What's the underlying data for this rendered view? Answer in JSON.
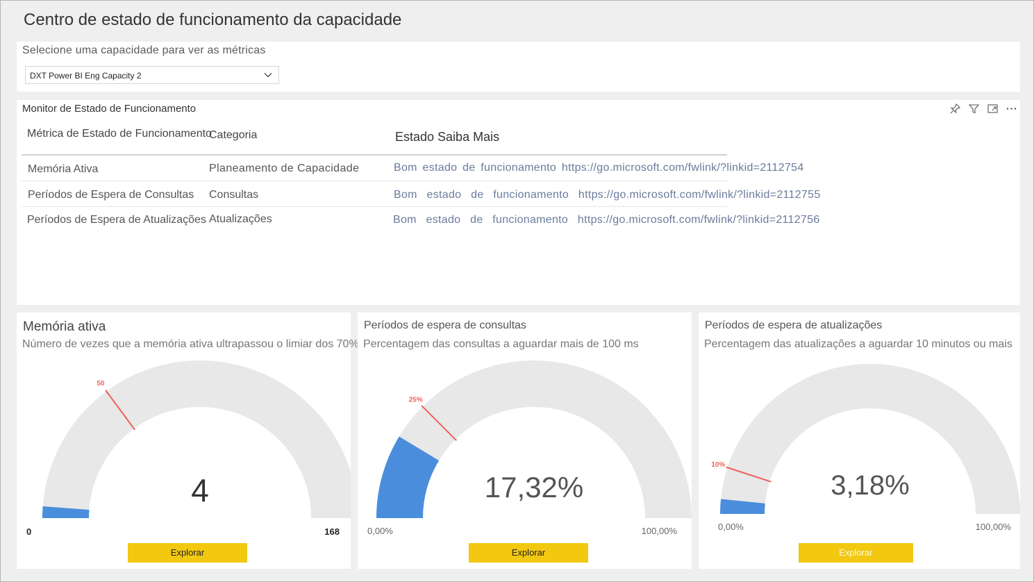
{
  "page_title": "Centro de estado de funcionamento da capacidade",
  "selector": {
    "label": "Selecione uma capacidade para ver as métricas",
    "value": "DXT Power BI Eng Capacity 2"
  },
  "health_table": {
    "title": "Monitor de Estado de Funcionamento",
    "columns": [
      "Métrica de Estado de Funcionamento",
      "Categoria",
      "Estado Saiba Mais"
    ],
    "rows": [
      {
        "metric": "Memória Ativa",
        "category": "Planeamento de Capacidade",
        "status": "Bom estado de funcionamento https://go.microsoft.com/fwlink/?linkid=2112754"
      },
      {
        "metric": "Períodos de Espera de Consultas",
        "category": "Consultas",
        "status": "Bom estado de funcionamento https://go.microsoft.com/fwlink/?linkid=2112755"
      },
      {
        "metric": "Períodos de Espera de Atualizações",
        "category": "Atualizações",
        "status": "Bom estado de funcionamento https://go.microsoft.com/fwlink/?linkid=2112756"
      }
    ],
    "icons": [
      "pin-icon",
      "filter-icon",
      "focus-mode-icon",
      "more-options-icon"
    ]
  },
  "colors": {
    "gauge_fill": "#4a8ddc",
    "gauge_track": "#e8e8e8",
    "target_line": "#f0605d",
    "explore_button": "#f2c811"
  },
  "gauges": [
    {
      "title": "Memória ativa",
      "subtitle": "Número de vezes que a memória ativa ultrapassou o limiar dos 70%",
      "value_label": "4",
      "min_label": "0",
      "max_label": "168",
      "target_label": "50",
      "value_fraction": 0.0238,
      "target_fraction": 0.2976,
      "button_label": "Explorar"
    },
    {
      "title": "Períodos de espera de consultas",
      "subtitle": "Percentagem das consultas a aguardar mais de 100 ms",
      "value_label": "17,32%",
      "min_label": "0,00%",
      "max_label": "100,00%",
      "target_label": "25%",
      "value_fraction": 0.1732,
      "target_fraction": 0.25,
      "button_label": "Explorar"
    },
    {
      "title": "Períodos de espera de atualizações",
      "subtitle": "Percentagem das atualizações a aguardar 10 minutos ou mais",
      "value_label": "3,18%",
      "min_label": "0,00%",
      "max_label": "100,00%",
      "target_label": "10%",
      "value_fraction": 0.0318,
      "target_fraction": 0.1,
      "button_label": "Explorar"
    }
  ]
}
